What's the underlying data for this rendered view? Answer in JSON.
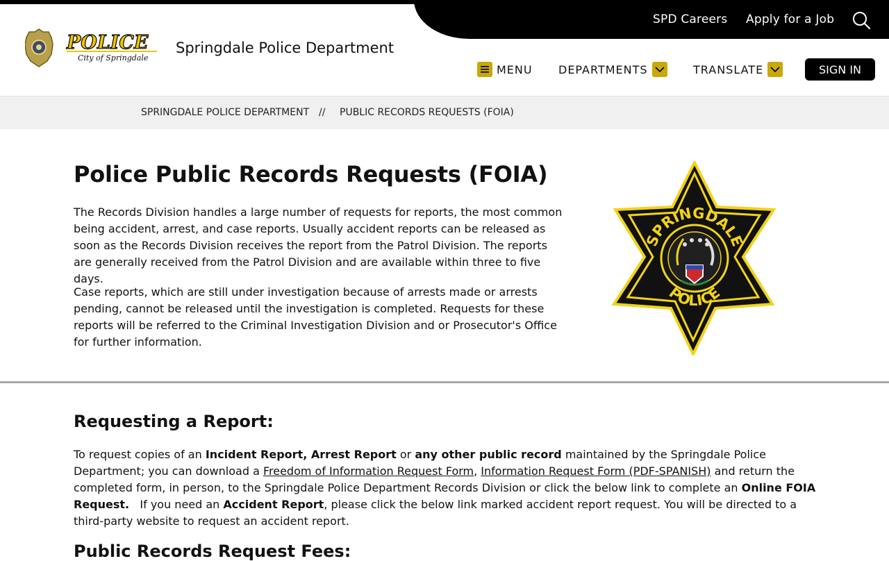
{
  "header": {
    "utility_links": [
      "SPD Careers",
      "Apply for a Job"
    ],
    "logo_word": "POLICE",
    "logo_sub": "City of Springdale",
    "site_title": "Springdale Police Department",
    "nav": {
      "menu": "MENU",
      "departments": "DEPARTMENTS",
      "translate": "TRANSLATE",
      "signin": "SIGN IN"
    }
  },
  "breadcrumb": {
    "home": "SPRINGDALE POLICE DEPARTMENT",
    "separator": "//",
    "current": "PUBLIC RECORDS REQUESTS (FOIA)"
  },
  "main": {
    "title": "Police Public Records Requests (FOIA)",
    "paragraph1": "The Records Division handles a large number of requests for reports, the most common being accident, arrest, and case reports. Usually accident reports can be released as soon as the Records Division receives the report from the Patrol Division. The reports are generally received from the Patrol Division and are available within three to five days.",
    "paragraph2": "Case reports, which are still under investigation because of arrests made or arrests pending, cannot be released until the investigation is completed. Requests for these reports will be referred to the Criminal Investigation Division and or Prosecutor's Office for further information.",
    "badge_top": "SPRINGDALE",
    "badge_bottom": "POLICE"
  },
  "requesting": {
    "heading": "Requesting a Report:",
    "t1": "To request copies of an ",
    "b1": "Incident Report, Arrest Report",
    "t2": " or ",
    "b2": "any other public record",
    "t3": " maintained by the Springdale Police Department; you can download a ",
    "link1": "Freedom of Information Request Form",
    "t4": ", ",
    "link2": "Information Request Form (PDF-SPANISH)",
    "t5": " and return the completed form, in person, to the Springdale Police Department Records Division or click the below link to complete an ",
    "b3": "Online FOIA Request.",
    "t6": "   If you need an ",
    "b4": "Accident Report",
    "t7": ", please click the below link marked accident report request. You will be directed to a third-party website to request an accident report."
  },
  "fees": {
    "heading": "Public Records Request Fees:"
  },
  "colors": {
    "accent_gold": "#c9a80a",
    "black": "#000000",
    "crumb_bg": "#f0f0f0"
  }
}
